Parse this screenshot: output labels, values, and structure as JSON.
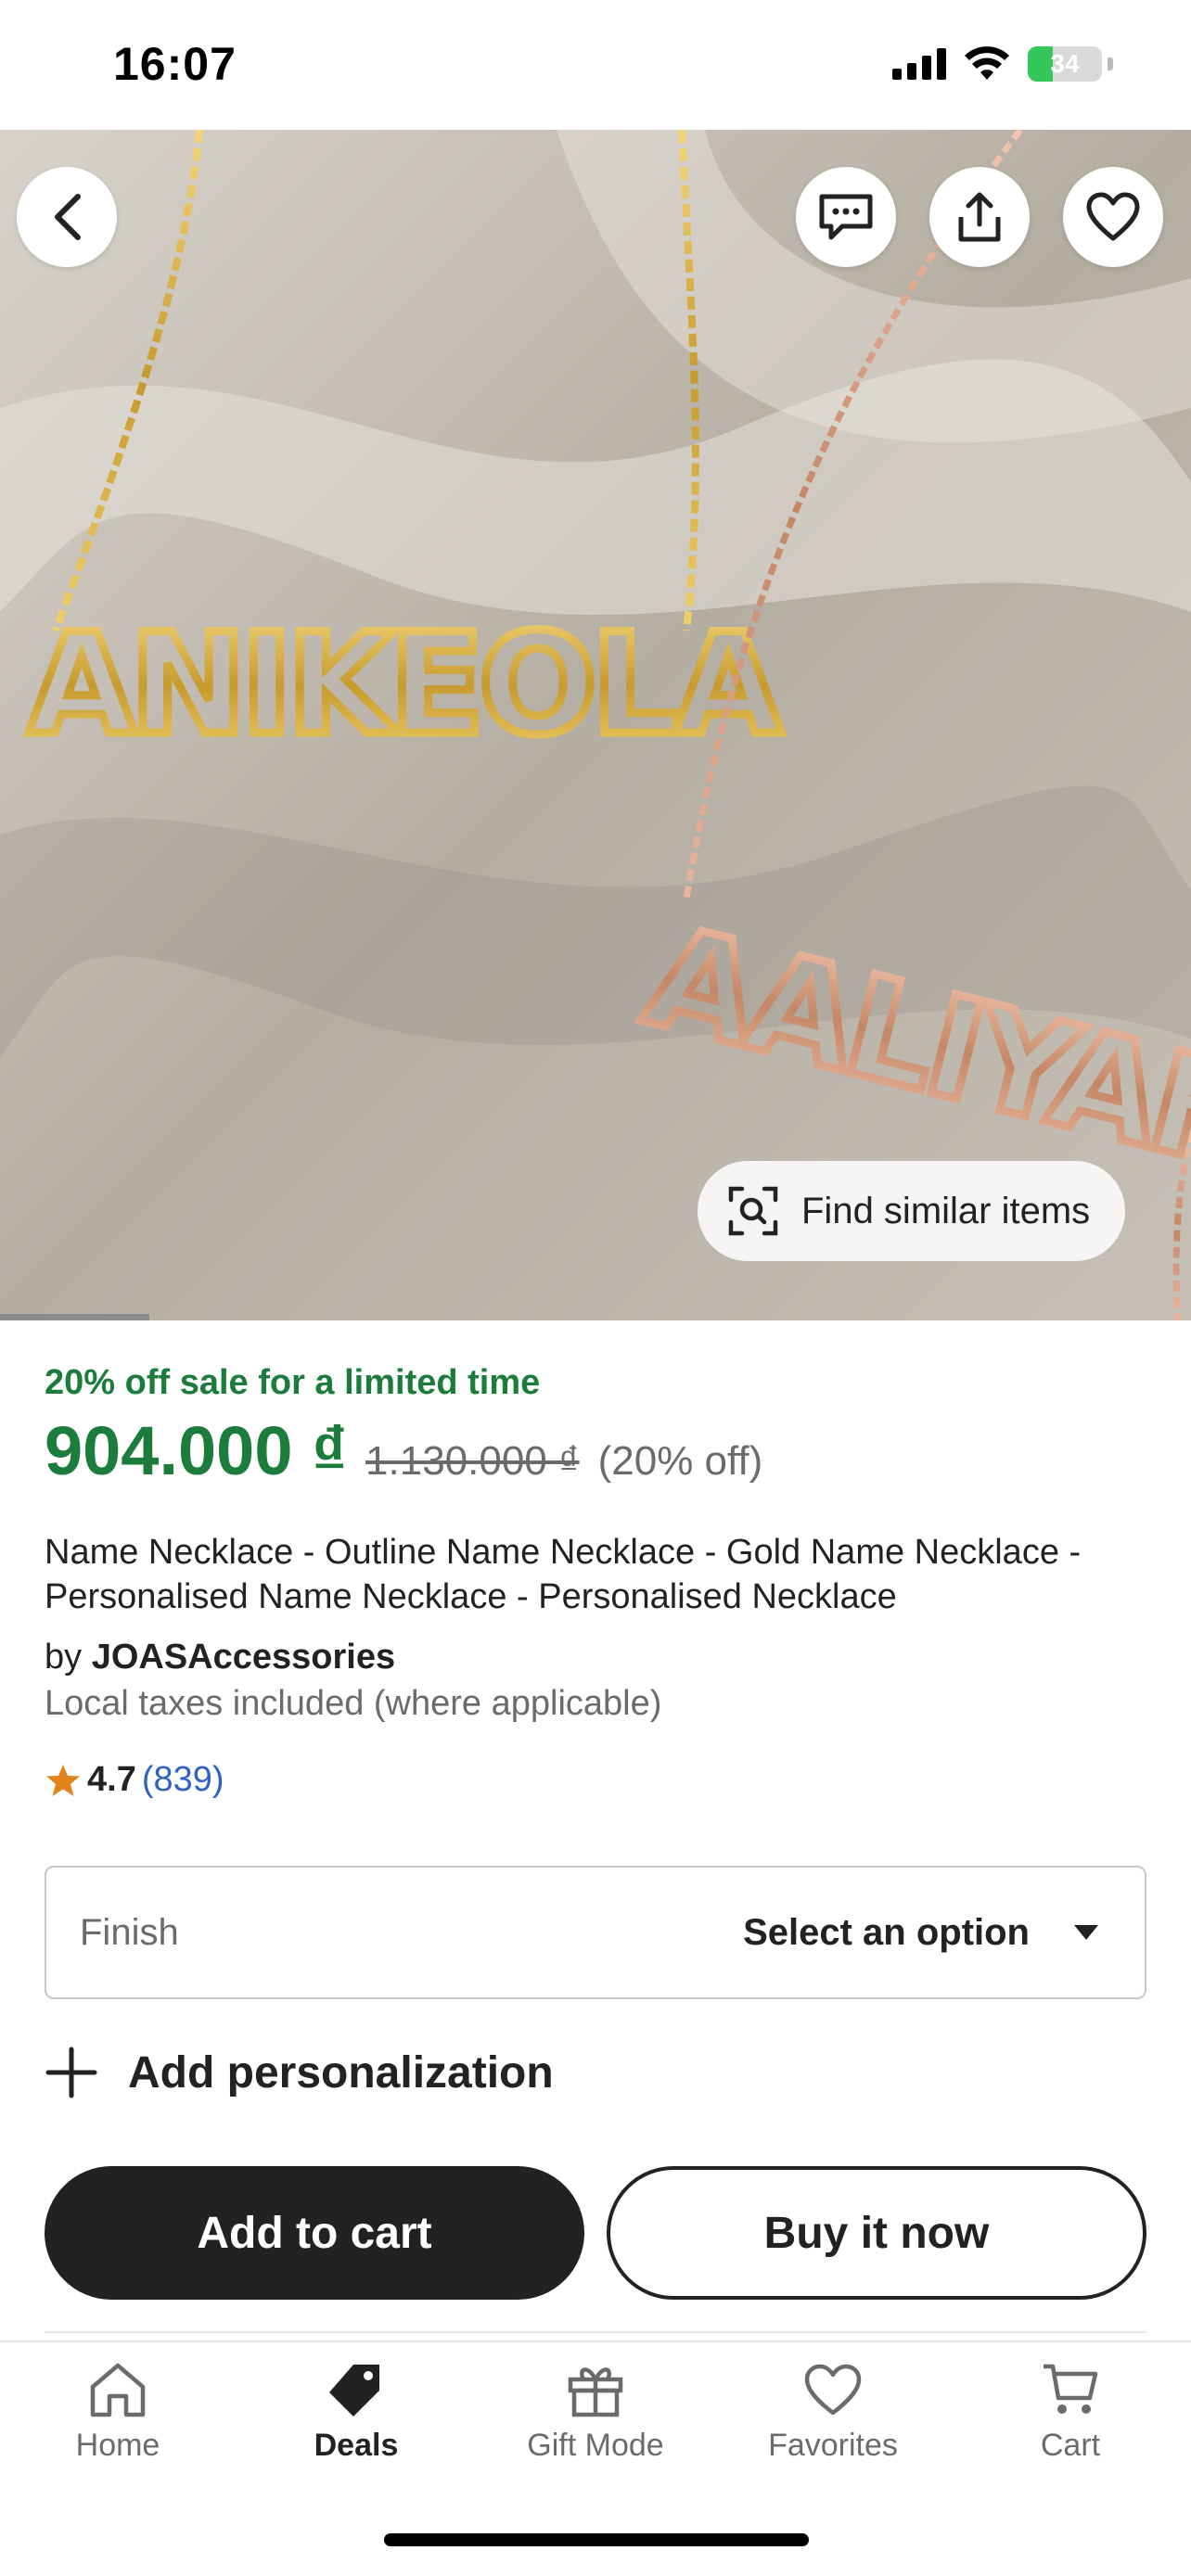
{
  "status_bar": {
    "time": "16:07",
    "battery": "34",
    "battery_level": 0.34
  },
  "hero": {
    "image_alt": "Gold and rose gold outline name necklaces on satin",
    "find_similar_label": "Find similar items",
    "carousel_progress": 0.125,
    "icons": {
      "back": "back-arrow-icon",
      "message": "message-icon",
      "share": "share-icon",
      "favorite": "heart-icon",
      "find": "visual-search-icon"
    }
  },
  "product": {
    "sale_text": "20% off sale for a limited time",
    "price": "904.000 ₫",
    "original_price": "1.130.000 ₫",
    "discount": "(20% off)",
    "title": "Name Necklace - Outline Name Necklace - Gold Name Necklace - Personalised Name Necklace - Personalised Necklace",
    "seller_prefix": "by",
    "seller": "JOASAccessories",
    "taxes": "Local taxes included (where applicable)",
    "rating": "4.7",
    "review_count": "(839)"
  },
  "options": {
    "finish_label": "Finish",
    "finish_value": "Select an option",
    "personalization_label": "Add personalization"
  },
  "actions": {
    "add_to_cart": "Add to cart",
    "buy_now": "Buy it now"
  },
  "tab_bar": {
    "items": [
      {
        "label": "Home",
        "icon": "home-icon"
      },
      {
        "label": "Deals",
        "icon": "tag-icon"
      },
      {
        "label": "Gift Mode",
        "icon": "gift-icon"
      },
      {
        "label": "Favorites",
        "icon": "heart-icon"
      },
      {
        "label": "Cart",
        "icon": "cart-icon"
      }
    ],
    "active": "Deals"
  },
  "colors": {
    "sale_green": "#1b7c3b",
    "link_blue": "#2e62c6",
    "dark": "#222222",
    "star": "#e2831a"
  }
}
